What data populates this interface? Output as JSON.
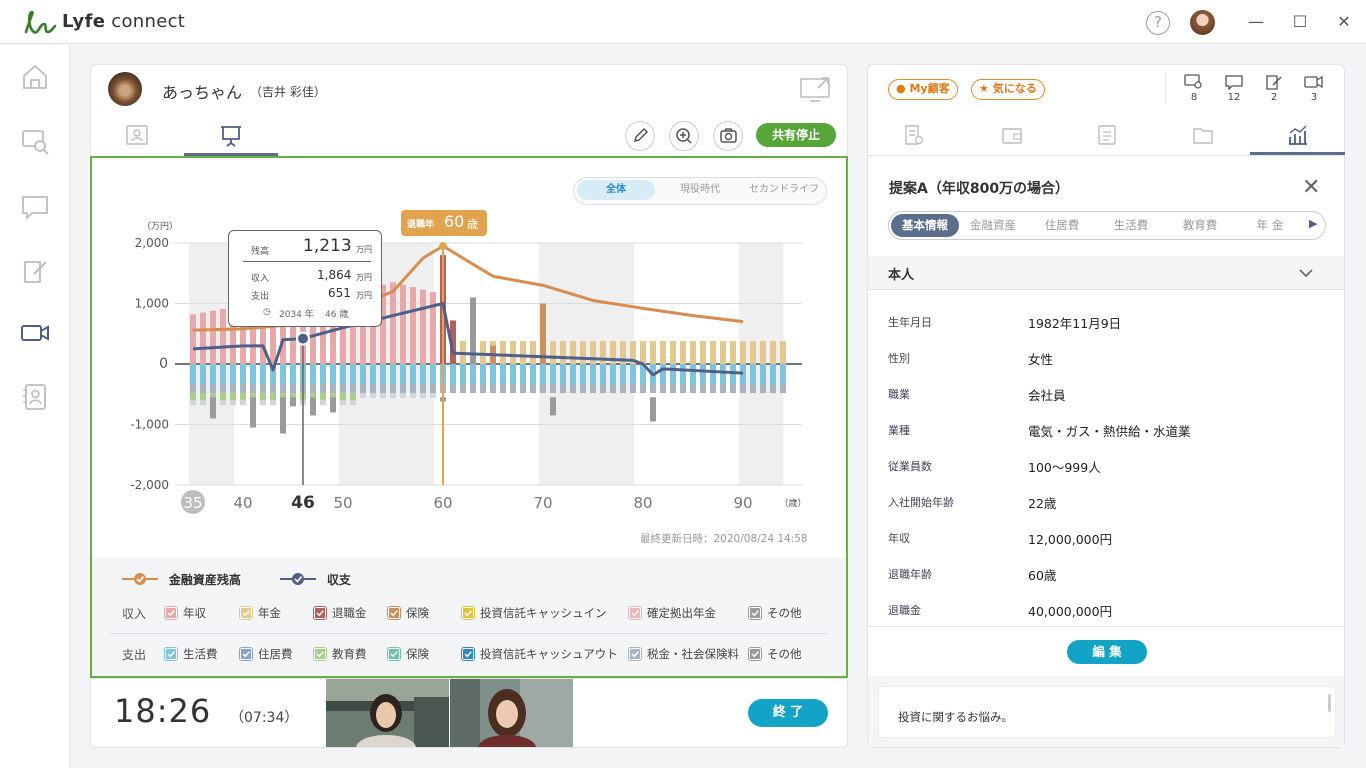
{
  "app": {
    "title_light": "connect",
    "title_bold": "Lyfe"
  },
  "window": {
    "help": "?",
    "minimize": "—",
    "maximize": "☐",
    "close": "✕"
  },
  "nav": [
    "home-icon",
    "customers-icon",
    "chat-icon",
    "notes-icon",
    "video-icon",
    "contacts-icon"
  ],
  "customer": {
    "nickname": "あっちゃん",
    "full_name": "（吉井 彩佳）"
  },
  "toolbar": {
    "share_stop": "共有停止"
  },
  "segments": [
    {
      "label": "全体",
      "active": true
    },
    {
      "label": "現役時代",
      "active": false
    },
    {
      "label": "セカンドライフ",
      "active": false
    }
  ],
  "chart_data": {
    "type": "bar",
    "yunit": "（万円）",
    "yticks": [
      "2,000",
      "1,000",
      "0",
      "-1,000",
      "-2,000"
    ],
    "ylim": [
      -2000,
      2000
    ],
    "xunit": "（歳）",
    "xticks": [
      "35",
      "40",
      "46",
      "50",
      "60",
      "70",
      "80",
      "90"
    ],
    "x_current": "46",
    "series": [
      {
        "name": "金融資産残高",
        "type": "line",
        "color": "#d98c4f",
        "x": [
          35,
          40,
          45,
          50,
          55,
          58,
          60,
          65,
          70,
          75,
          80,
          85,
          90
        ],
        "values": [
          560,
          580,
          650,
          850,
          1200,
          1750,
          1950,
          1450,
          1300,
          1050,
          920,
          800,
          700
        ]
      },
      {
        "name": "収支",
        "type": "line",
        "color": "#4e5f8a",
        "x": [
          35,
          40,
          42,
          43,
          44,
          46,
          50,
          55,
          60,
          61,
          70,
          79,
          80,
          81,
          82,
          90
        ],
        "values": [
          250,
          300,
          300,
          -100,
          400,
          420,
          600,
          800,
          1000,
          180,
          120,
          60,
          0,
          -180,
          -80,
          -150
        ]
      }
    ],
    "tooltip": {
      "label": "残高",
      "value": "1,213",
      "unit": "万円",
      "income_label": "収入",
      "income": "1,864",
      "expense_label": "支出",
      "expense": "651",
      "year": "2034 年",
      "age": "46 歳"
    },
    "retire_badge": {
      "label": "退職年",
      "age": "60",
      "unit": "歳"
    }
  },
  "updated": "最終更新日時：2020/08/24 14:58",
  "legend": {
    "lines": [
      {
        "label": "金融資産残高",
        "color": "#d98c4f"
      },
      {
        "label": "収支",
        "color": "#4e5f8a"
      }
    ],
    "income_label": "収入",
    "income": [
      {
        "label": "年収",
        "color": "#e8a7a9"
      },
      {
        "label": "年金",
        "color": "#e3c98f"
      },
      {
        "label": "退職金",
        "color": "#b55e5e"
      },
      {
        "label": "保険",
        "color": "#cf8f5c"
      },
      {
        "label": "投資信託キャッシュイン",
        "color": "#e6c23a"
      },
      {
        "label": "確定拠出年金",
        "color": "#edb6b6"
      },
      {
        "label": "その他",
        "color": "#9a9a9a"
      }
    ],
    "expense_label": "支出",
    "expense": [
      {
        "label": "生活費",
        "color": "#7ec4dc"
      },
      {
        "label": "住居費",
        "color": "#8aa0cf"
      },
      {
        "label": "教育費",
        "color": "#a9d08a"
      },
      {
        "label": "保険",
        "color": "#6fc3a8"
      },
      {
        "label": "投資信託キャッシュアウト",
        "color": "#2f86c8"
      },
      {
        "label": "税金・社会保険料",
        "color": "#a9b4c2"
      },
      {
        "label": "その他",
        "color": "#9a9a9a"
      }
    ]
  },
  "call": {
    "elapsed": "18:26",
    "sub": "（07:34）",
    "end": "終 了"
  },
  "tags": [
    {
      "label": "My顧客"
    },
    {
      "label": "気になる"
    }
  ],
  "stats": [
    {
      "icon": "customer-chat-icon",
      "value": "8"
    },
    {
      "icon": "message-icon",
      "value": "12"
    },
    {
      "icon": "note-icon",
      "value": "2"
    },
    {
      "icon": "video-icon",
      "value": "3"
    }
  ],
  "proposal": {
    "title": "提案A（年収800万の場合）",
    "pills": [
      "基本情報",
      "金融資産",
      "住居費",
      "生活費",
      "教育費",
      "年 金"
    ],
    "section": "本人",
    "rows": [
      {
        "label": "生年月日",
        "value": "1982年11月9日"
      },
      {
        "label": "性別",
        "value": "女性"
      },
      {
        "label": "職業",
        "value": "会社員"
      },
      {
        "label": "業種",
        "value": "電気・ガス・熱供給・水道業"
      },
      {
        "label": "従業員数",
        "value": "100〜999人"
      },
      {
        "label": "入社開始年齢",
        "value": "22歳"
      },
      {
        "label": "年収",
        "value": "12,000,000円"
      },
      {
        "label": "退職年齢",
        "value": "60歳"
      },
      {
        "label": "退職金",
        "value": "40,000,000円"
      }
    ],
    "edit": "編 集",
    "note": "投資に関するお悩み。"
  }
}
